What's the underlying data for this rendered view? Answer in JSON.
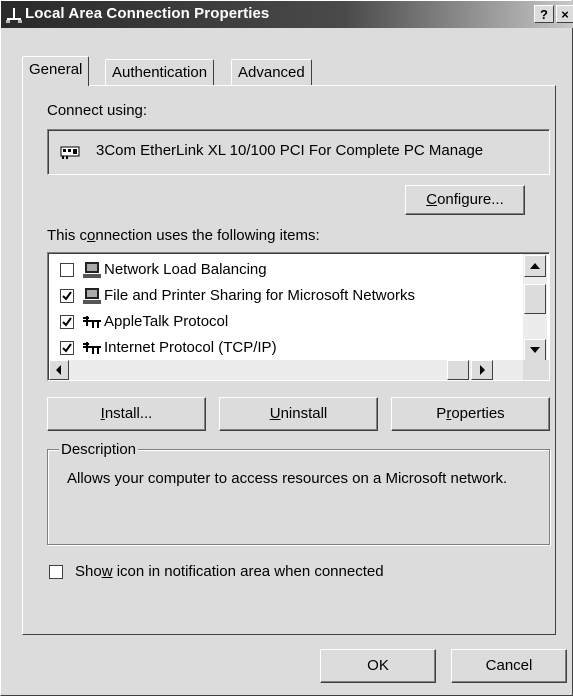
{
  "window": {
    "title": "Local Area Connection Properties",
    "help_label": "?",
    "close_label": "×"
  },
  "tabs": [
    {
      "label": "General",
      "selected": true
    },
    {
      "label": "Authentication",
      "selected": false
    },
    {
      "label": "Advanced",
      "selected": false
    }
  ],
  "general": {
    "connect_using_label": "Connect using:",
    "adapter_name": "3Com EtherLink XL 10/100 PCI For Complete PC Manage",
    "configure_pre": "",
    "configure_ul": "C",
    "configure_post": "onfigure...",
    "items_label_pre": "This c",
    "items_label_ul": "o",
    "items_label_post": "nnection uses the following items:",
    "items": [
      {
        "label": "Network Load Balancing",
        "checked": false,
        "icon": "computer-icon"
      },
      {
        "label": "File and Printer Sharing for Microsoft Networks",
        "checked": true,
        "icon": "computer-icon"
      },
      {
        "label": "AppleTalk Protocol",
        "checked": true,
        "icon": "network-protocol-icon"
      },
      {
        "label": "Internet Protocol (TCP/IP)",
        "checked": true,
        "icon": "network-protocol-icon"
      }
    ],
    "install_pre": "",
    "install_ul": "I",
    "install_post": "nstall...",
    "uninstall_pre": "",
    "uninstall_ul": "U",
    "uninstall_post": "ninstall",
    "properties_pre": "P",
    "properties_ul": "r",
    "properties_post": "operties",
    "description_legend": "Description",
    "description_text": "Allows your computer to access resources on a Microsoft network.",
    "show_icon_pre": "Sho",
    "show_icon_ul": "w",
    "show_icon_post": " icon in notification area when connected",
    "show_icon_checked": false
  },
  "footer": {
    "ok_label": "OK",
    "cancel_label": "Cancel"
  }
}
